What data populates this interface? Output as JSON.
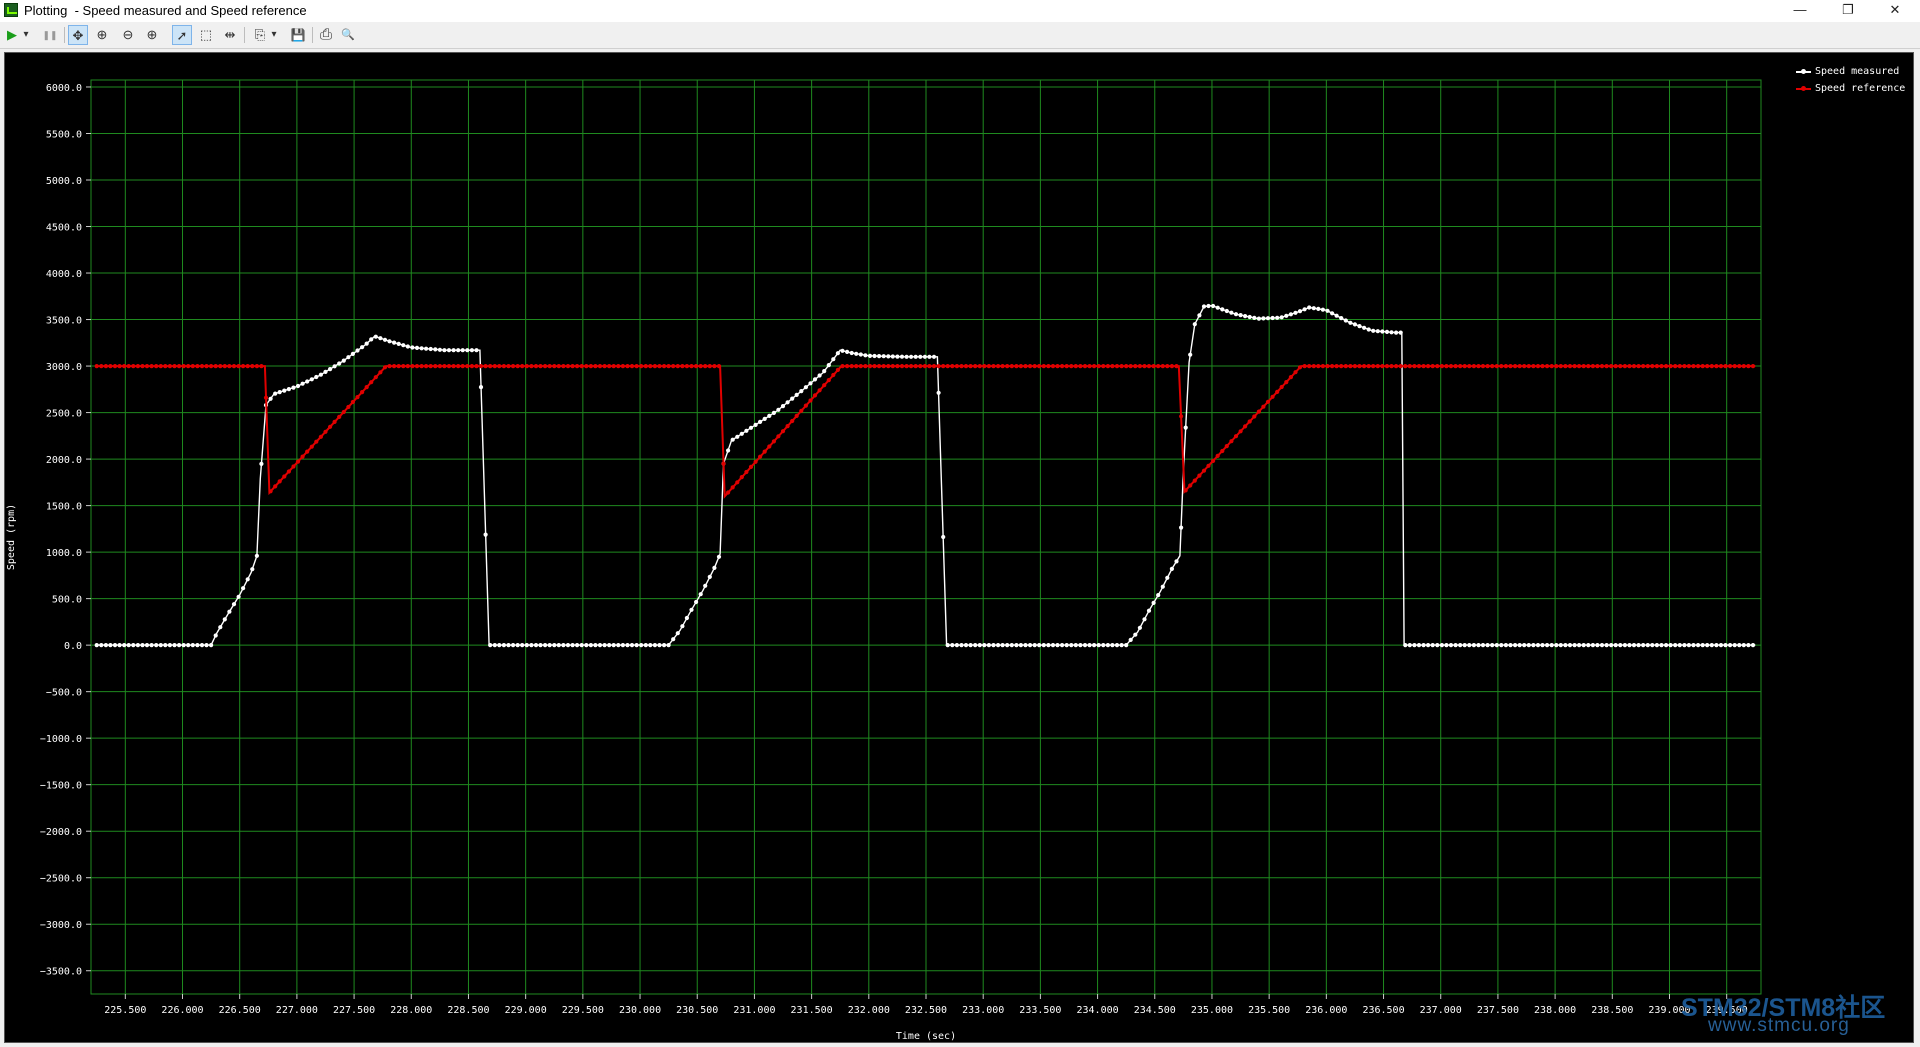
{
  "window": {
    "title": "Plotting  - Speed measured and Speed reference",
    "minimize": "—",
    "restore": "❐",
    "close": "✕"
  },
  "toolbar": {
    "items": [
      {
        "name": "play-icon",
        "glyph": "▶"
      },
      {
        "name": "play-dropdown-icon",
        "glyph": "▾"
      },
      {
        "name": "pause-icon",
        "glyph": "❚❚"
      },
      {
        "name": "pan-icon",
        "glyph": "✥"
      },
      {
        "name": "zoom-area-icon",
        "glyph": "⊕"
      },
      {
        "name": "zoom-out-icon",
        "glyph": "⊖"
      },
      {
        "name": "zoom-in-icon",
        "glyph": "⊕"
      },
      {
        "name": "pointer-icon",
        "glyph": "➚"
      },
      {
        "name": "select-box-icon",
        "glyph": "⬚"
      },
      {
        "name": "fit-icon",
        "glyph": "⇹"
      },
      {
        "name": "copy-icon",
        "glyph": "⎘"
      },
      {
        "name": "copy-dropdown-icon",
        "glyph": "▾"
      },
      {
        "name": "save-icon",
        "glyph": "💾"
      },
      {
        "name": "print-icon",
        "glyph": "⎙"
      },
      {
        "name": "print-preview-icon",
        "glyph": "🔍"
      }
    ]
  },
  "colors": {
    "background": "#000000",
    "grid": "#1f8a1f",
    "measured": "#ffffff",
    "reference": "#e00000",
    "tick_text": "#ffffff"
  },
  "legend": {
    "measured": "Speed measured",
    "reference": "Speed reference"
  },
  "watermark": {
    "line1": "STM32/STM8社区",
    "line2": "www.stmcu.org"
  },
  "chart_data": {
    "type": "line",
    "xlabel": "Time (sec)",
    "ylabel": "Speed (rpm)",
    "xlim": [
      225.2,
      239.8
    ],
    "ylim": [
      -3750,
      6075
    ],
    "x_ticks": [
      225.5,
      226.0,
      226.5,
      227.0,
      227.5,
      228.0,
      228.5,
      229.0,
      229.5,
      230.0,
      230.5,
      231.0,
      231.5,
      232.0,
      232.5,
      233.0,
      233.5,
      234.0,
      234.5,
      235.0,
      235.5,
      236.0,
      236.5,
      237.0,
      237.5,
      238.0,
      238.5,
      239.0,
      239.5
    ],
    "x_tick_labels": [
      "225.500",
      "226.000",
      "226.500",
      "227.000",
      "227.500",
      "228.000",
      "228.500",
      "229.000",
      "229.500",
      "230.000",
      "230.500",
      "231.000",
      "231.500",
      "232.000",
      "232.500",
      "233.000",
      "233.500",
      "234.000",
      "234.500",
      "235.000",
      "235.500",
      "236.000",
      "236.500",
      "237.000",
      "237.500",
      "238.000",
      "238.500",
      "239.000",
      "239.500"
    ],
    "y_ticks": [
      6000,
      5500,
      5000,
      4500,
      4000,
      3500,
      3000,
      2500,
      2000,
      1500,
      1000,
      500,
      0,
      -500,
      -1000,
      -1500,
      -2000,
      -2500,
      -3000,
      -3500
    ],
    "y_tick_labels": [
      "6000.0",
      "5500.0",
      "5000.0",
      "4500.0",
      "4000.0",
      "3500.0",
      "3000.0",
      "2500.0",
      "2000.0",
      "1500.0",
      "1000.0",
      "500.0",
      "0.0",
      "−500.0",
      "−1000.0",
      "−1500.0",
      "−2000.0",
      "−2500.0",
      "−3000.0",
      "−3500.0"
    ],
    "grid": true,
    "legend_position": "top-right, outside plot",
    "series": [
      {
        "name": "Speed measured",
        "points": [
          [
            225.25,
            0
          ],
          [
            225.5,
            0
          ],
          [
            225.6,
            0
          ],
          [
            226.0,
            0
          ],
          [
            226.25,
            0
          ],
          [
            226.3,
            130
          ],
          [
            226.4,
            340
          ],
          [
            226.5,
            540
          ],
          [
            226.6,
            780
          ],
          [
            226.65,
            960
          ],
          [
            226.68,
            1790
          ],
          [
            226.73,
            2580
          ],
          [
            226.8,
            2700
          ],
          [
            227.0,
            2780
          ],
          [
            227.2,
            2900
          ],
          [
            227.4,
            3050
          ],
          [
            227.6,
            3230
          ],
          [
            227.68,
            3320
          ],
          [
            227.8,
            3270
          ],
          [
            228.0,
            3200
          ],
          [
            228.3,
            3170
          ],
          [
            228.6,
            3170
          ],
          [
            228.68,
            0
          ],
          [
            229.0,
            0
          ],
          [
            229.3,
            0
          ],
          [
            229.6,
            0
          ],
          [
            230.0,
            0
          ],
          [
            230.25,
            0
          ],
          [
            230.35,
            160
          ],
          [
            230.45,
            380
          ],
          [
            230.55,
            590
          ],
          [
            230.65,
            830
          ],
          [
            230.7,
            980
          ],
          [
            230.73,
            1950
          ],
          [
            230.8,
            2200
          ],
          [
            230.95,
            2320
          ],
          [
            231.2,
            2520
          ],
          [
            231.4,
            2720
          ],
          [
            231.6,
            2930
          ],
          [
            231.75,
            3170
          ],
          [
            231.85,
            3140
          ],
          [
            232.0,
            3110
          ],
          [
            232.3,
            3100
          ],
          [
            232.6,
            3100
          ],
          [
            232.68,
            0
          ],
          [
            233.0,
            0
          ],
          [
            233.3,
            0
          ],
          [
            233.6,
            0
          ],
          [
            234.0,
            0
          ],
          [
            234.25,
            0
          ],
          [
            234.35,
            140
          ],
          [
            234.45,
            370
          ],
          [
            234.55,
            580
          ],
          [
            234.65,
            820
          ],
          [
            234.72,
            960
          ],
          [
            234.75,
            1870
          ],
          [
            234.8,
            3040
          ],
          [
            234.85,
            3450
          ],
          [
            234.93,
            3640
          ],
          [
            235.0,
            3650
          ],
          [
            235.2,
            3560
          ],
          [
            235.4,
            3510
          ],
          [
            235.6,
            3520
          ],
          [
            235.75,
            3580
          ],
          [
            235.85,
            3630
          ],
          [
            236.0,
            3600
          ],
          [
            236.2,
            3470
          ],
          [
            236.4,
            3380
          ],
          [
            236.6,
            3360
          ],
          [
            236.66,
            3360
          ],
          [
            236.68,
            0
          ],
          [
            237.0,
            0
          ],
          [
            237.5,
            0
          ],
          [
            238.0,
            0
          ],
          [
            238.5,
            0
          ],
          [
            239.0,
            0
          ],
          [
            239.5,
            0
          ],
          [
            239.75,
            0
          ]
        ]
      },
      {
        "name": "Speed reference",
        "points": [
          [
            225.25,
            3000
          ],
          [
            226.72,
            3000
          ],
          [
            226.76,
            1640
          ],
          [
            227.78,
            3000
          ],
          [
            230.7,
            3000
          ],
          [
            230.74,
            1600
          ],
          [
            231.76,
            3000
          ],
          [
            234.71,
            3000
          ],
          [
            234.76,
            1650
          ],
          [
            235.78,
            3000
          ],
          [
            239.75,
            3000
          ]
        ]
      }
    ]
  }
}
